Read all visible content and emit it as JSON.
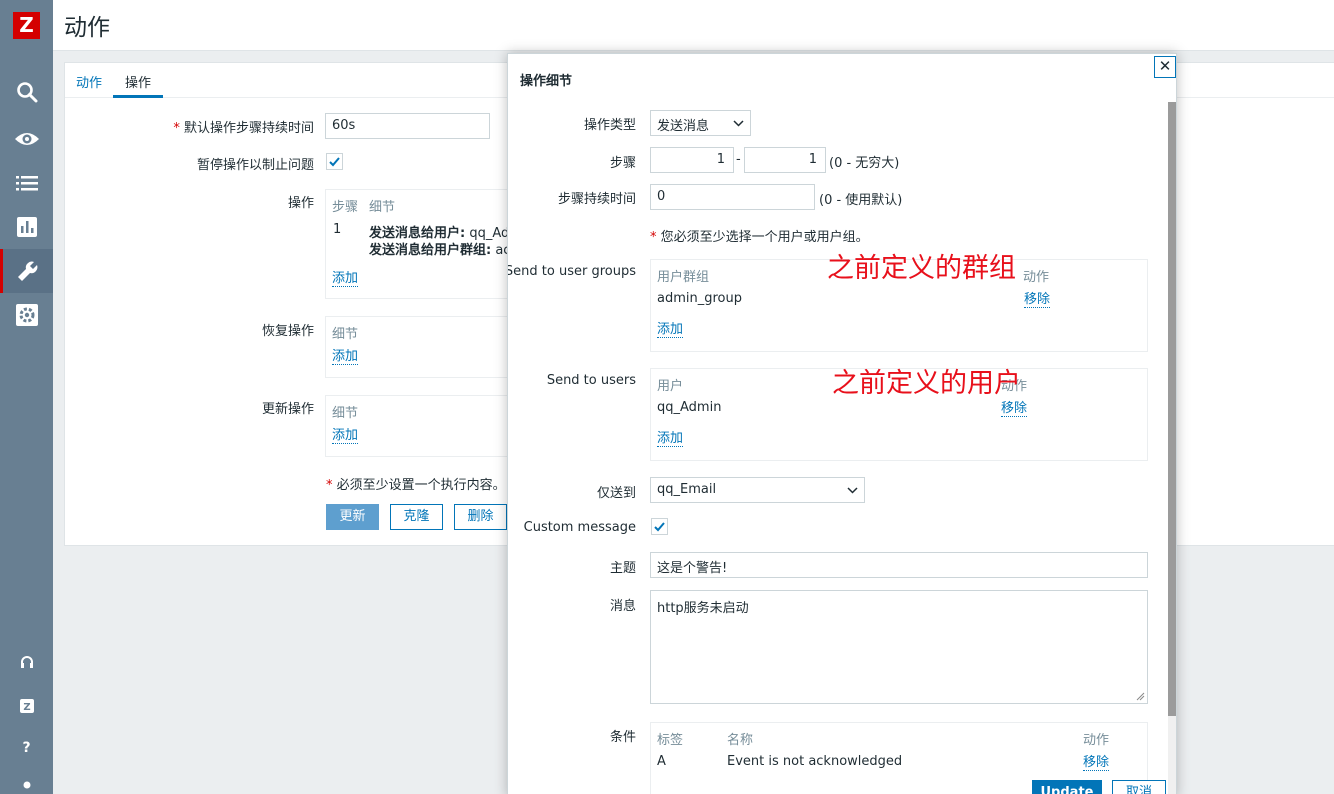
{
  "sidebar": {
    "logo_text": "Z",
    "items": [
      {
        "icon": "search-icon"
      },
      {
        "icon": "eye-icon"
      },
      {
        "icon": "list-icon"
      },
      {
        "icon": "chart-icon"
      },
      {
        "icon": "wrench-icon"
      },
      {
        "icon": "cog-icon"
      }
    ],
    "bottom": [
      {
        "icon": "headset-icon"
      },
      {
        "icon": "share-icon",
        "text": "Z"
      },
      {
        "icon": "help-icon",
        "text": "?"
      },
      {
        "icon": "user-icon"
      }
    ]
  },
  "header": {
    "title": "动作"
  },
  "tabs": [
    {
      "label": "动作",
      "active": false
    },
    {
      "label": "操作",
      "active": true
    }
  ],
  "form": {
    "default_step_duration": {
      "required_mark": "*",
      "label": "默认操作步骤持续时间",
      "value": "60s"
    },
    "pause": {
      "label": "暂停操作以制止问题",
      "checked": true
    },
    "operations": {
      "label": "操作",
      "headers": [
        "步骤",
        "细节"
      ],
      "rows": [
        {
          "step": "1",
          "line1_bold": "发送消息给用户:",
          "line1_rest": "qq_Ad",
          "line2_bold": "发送消息给用户群组:",
          "line2_rest": "ac"
        }
      ],
      "add": "添加"
    },
    "recovery": {
      "label": "恢复操作",
      "header": "细节",
      "add": "添加"
    },
    "update": {
      "label": "更新操作",
      "header": "细节",
      "add": "添加"
    },
    "warning": {
      "mark": "*",
      "text": "必须至少设置一个执行内容。"
    },
    "buttons": {
      "update": "更新",
      "clone": "克隆",
      "delete": "删除"
    }
  },
  "modal": {
    "title": "操作细节",
    "close": "✕",
    "operation_type": {
      "label": "操作类型",
      "value": "发送消息"
    },
    "steps": {
      "label": "步骤",
      "from": "1",
      "sep": "-",
      "to": "1",
      "hint": "(0 - 无穷大)"
    },
    "step_duration": {
      "label": "步骤持续时间",
      "value": "0",
      "hint": "(0 - 使用默认)"
    },
    "notice": {
      "mark": "*",
      "text": "您必须至少选择一个用户或用户组。"
    },
    "user_groups": {
      "label": "Send to user groups",
      "headers": [
        "用户群组",
        "动作"
      ],
      "rows": [
        {
          "name": "admin_group",
          "action": "移除"
        }
      ],
      "add": "添加"
    },
    "users": {
      "label": "Send to users",
      "headers": [
        "用户",
        "动作"
      ],
      "rows": [
        {
          "name": "qq_Admin",
          "action": "移除"
        }
      ],
      "add": "添加"
    },
    "send_only_to": {
      "label": "仅送到",
      "value": "qq_Email"
    },
    "custom_message": {
      "label": "Custom message",
      "checked": true
    },
    "subject": {
      "label": "主题",
      "value": "这是个警告!"
    },
    "message": {
      "label": "消息",
      "value": "http服务未启动"
    },
    "conditions": {
      "label": "条件",
      "headers": [
        "标签",
        "名称",
        "动作"
      ],
      "rows": [
        {
          "tag": "A",
          "name": "Event is not acknowledged",
          "action": "移除"
        }
      ]
    },
    "buttons": {
      "update": "Update",
      "cancel": "取消"
    }
  },
  "annotations": {
    "groups_note": "之前定义的群组",
    "users_note": "之前定义的用户"
  },
  "colors": {
    "sidebar": "#687f92",
    "accent": "#0275b8",
    "logo": "#d40000",
    "annotation": "#e8101b"
  }
}
